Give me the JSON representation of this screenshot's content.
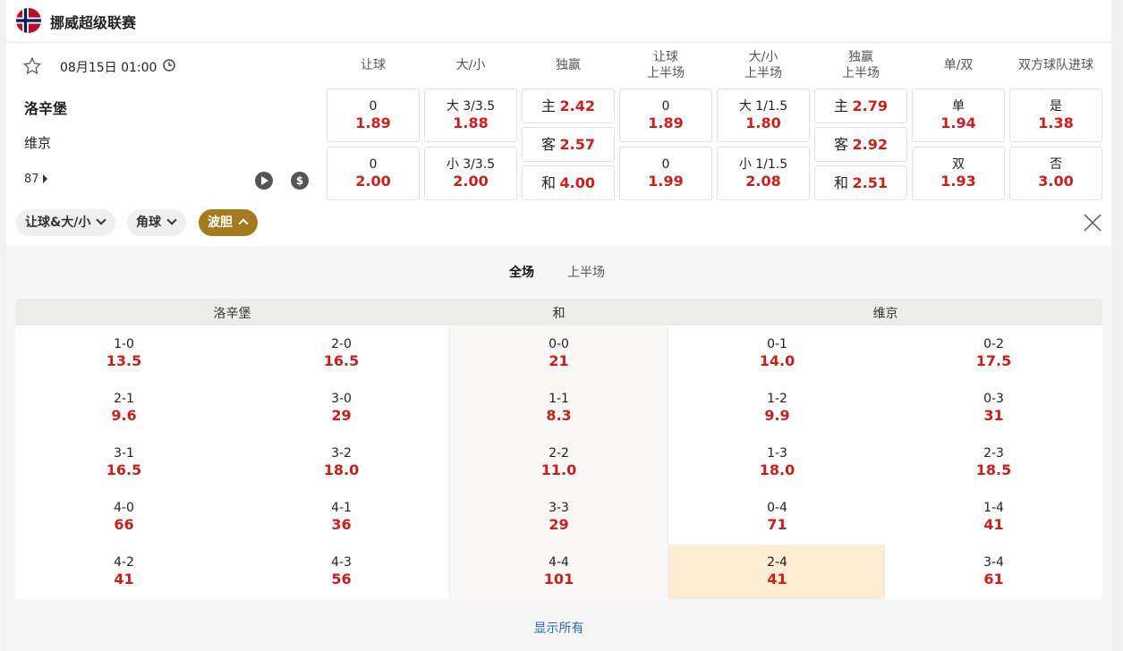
{
  "league": {
    "name": "挪威超级联赛"
  },
  "match": {
    "kickoff": "08月15日 01:00",
    "home": "洛辛堡",
    "away": "维京",
    "more_count": "87"
  },
  "columns": [
    "让球",
    "大/小",
    "独赢",
    "让球\n上半场",
    "大/小\n上半场",
    "独赢\n上半场",
    "单/双",
    "双方球队进球"
  ],
  "odds": {
    "hc_ft": [
      {
        "label": "0",
        "value": "1.89"
      },
      {
        "label": "0",
        "value": "2.00"
      }
    ],
    "ou_ft": [
      {
        "label": "大 3/3.5",
        "value": "1.88"
      },
      {
        "label": "小 3/3.5",
        "value": "2.00"
      }
    ],
    "ml_ft": [
      {
        "label": "主",
        "value": "2.42"
      },
      {
        "label": "客",
        "value": "2.57"
      },
      {
        "label": "和",
        "value": "4.00"
      }
    ],
    "hc_ht": [
      {
        "label": "0",
        "value": "1.89"
      },
      {
        "label": "0",
        "value": "1.99"
      }
    ],
    "ou_ht": [
      {
        "label": "大 1/1.5",
        "value": "1.80"
      },
      {
        "label": "小 1/1.5",
        "value": "2.08"
      }
    ],
    "ml_ht": [
      {
        "label": "主",
        "value": "2.79"
      },
      {
        "label": "客",
        "value": "2.92"
      },
      {
        "label": "和",
        "value": "2.51"
      }
    ],
    "oe": [
      {
        "label": "单",
        "value": "1.94"
      },
      {
        "label": "双",
        "value": "1.93"
      }
    ],
    "btts": [
      {
        "label": "是",
        "value": "1.38"
      },
      {
        "label": "否",
        "value": "3.00"
      }
    ]
  },
  "tags": [
    "让球&大/小",
    "角球",
    "波胆"
  ],
  "correct_score": {
    "tabs": [
      "全场",
      "上半场"
    ],
    "headers": [
      "洛辛堡",
      "和",
      "维京"
    ],
    "rows": [
      [
        [
          "1-0",
          "13.5"
        ],
        [
          "2-0",
          "16.5"
        ],
        [
          "0-0",
          "21"
        ],
        [
          "0-1",
          "14.0"
        ],
        [
          "0-2",
          "17.5"
        ]
      ],
      [
        [
          "2-1",
          "9.6"
        ],
        [
          "3-0",
          "29"
        ],
        [
          "1-1",
          "8.3"
        ],
        [
          "1-2",
          "9.9"
        ],
        [
          "0-3",
          "31"
        ]
      ],
      [
        [
          "3-1",
          "16.5"
        ],
        [
          "3-2",
          "18.0"
        ],
        [
          "2-2",
          "11.0"
        ],
        [
          "1-3",
          "18.0"
        ],
        [
          "2-3",
          "18.5"
        ]
      ],
      [
        [
          "4-0",
          "66"
        ],
        [
          "4-1",
          "36"
        ],
        [
          "3-3",
          "29"
        ],
        [
          "0-4",
          "71"
        ],
        [
          "1-4",
          "41"
        ]
      ],
      [
        [
          "4-2",
          "41"
        ],
        [
          "4-3",
          "56"
        ],
        [
          "4-4",
          "101"
        ],
        [
          "2-4",
          "41"
        ],
        [
          "3-4",
          "61"
        ]
      ]
    ],
    "show_all": "显示所有"
  }
}
